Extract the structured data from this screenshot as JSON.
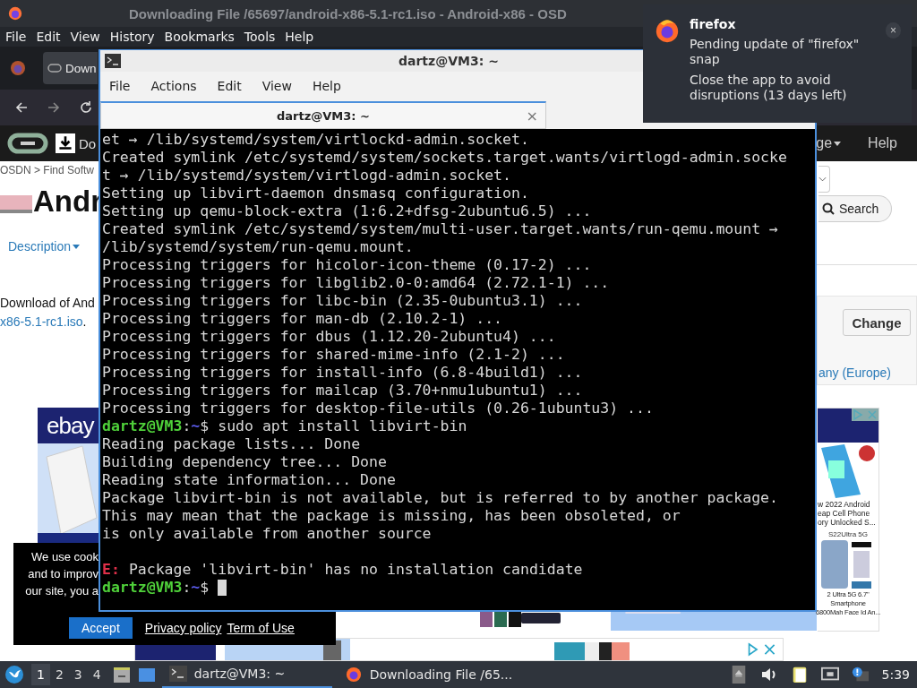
{
  "browser": {
    "title": "Downloading File /65697/android-x86-5.1-rc1.iso - Android-x86 - OSD",
    "menu": [
      "File",
      "Edit",
      "View",
      "History",
      "Bookmarks",
      "Tools",
      "Help"
    ],
    "tab": {
      "label": "Down"
    },
    "site": {
      "download_label": "Do",
      "nav": [
        {
          "label": "ge",
          "dropdown": true
        },
        {
          "label": "Help"
        }
      ],
      "breadcrumb": "OSDN > Find Softw",
      "heading": "Andr",
      "subnav": {
        "label": "Description",
        "dropdown": true
      },
      "search_button": "Search",
      "download_text": "Download of And",
      "file_link": "x86-5.1-rc1.iso",
      "file_link_end": ".",
      "change_button": "Change",
      "mirror": "any (Europe)",
      "ads": {
        "left_brand": "ebay",
        "right_lines": [
          "w 2022 Android",
          "eap Cell Phone",
          "ory Unlocked S..."
        ],
        "right_tag": "S22Ultra 5G",
        "right_lines_2": [
          "2 Ultra 5G 6.7\"",
          "Smartphone",
          "6800Mah Face Id An..."
        ]
      },
      "cookie": {
        "lines": [
          "We use cook",
          "and to improv",
          "our site, you a"
        ],
        "accept": "Accept",
        "links": [
          "Privacy policy",
          "Term of Use"
        ]
      }
    }
  },
  "terminal": {
    "title": "dartz@VM3: ~",
    "menu": [
      "File",
      "Actions",
      "Edit",
      "View",
      "Help"
    ],
    "tab": {
      "label": "dartz@VM3: ~",
      "close": "×"
    },
    "lines": [
      {
        "kind": "output",
        "text": "et → /lib/systemd/system/virtlockd-admin.socket."
      },
      {
        "kind": "output",
        "text": "Created symlink /etc/systemd/system/sockets.target.wants/virtlogd-admin.socke"
      },
      {
        "kind": "output",
        "text": "t → /lib/systemd/system/virtlogd-admin.socket."
      },
      {
        "kind": "output",
        "text": "Setting up libvirt-daemon dnsmasq configuration."
      },
      {
        "kind": "output",
        "text": "Setting up qemu-block-extra (1:6.2+dfsg-2ubuntu6.5) ..."
      },
      {
        "kind": "output",
        "text": "Created symlink /etc/systemd/system/multi-user.target.wants/run-qemu.mount →"
      },
      {
        "kind": "output",
        "text": "/lib/systemd/system/run-qemu.mount."
      },
      {
        "kind": "output",
        "text": "Processing triggers for hicolor-icon-theme (0.17-2) ..."
      },
      {
        "kind": "output",
        "text": "Processing triggers for libglib2.0-0:amd64 (2.72.1-1) ..."
      },
      {
        "kind": "output",
        "text": "Processing triggers for libc-bin (2.35-0ubuntu3.1) ..."
      },
      {
        "kind": "output",
        "text": "Processing triggers for man-db (2.10.2-1) ..."
      },
      {
        "kind": "output",
        "text": "Processing triggers for dbus (1.12.20-2ubuntu4) ..."
      },
      {
        "kind": "output",
        "text": "Processing triggers for shared-mime-info (2.1-2) ..."
      },
      {
        "kind": "output",
        "text": "Processing triggers for install-info (6.8-4build1) ..."
      },
      {
        "kind": "output",
        "text": "Processing triggers for mailcap (3.70+nmu1ubuntu1) ..."
      },
      {
        "kind": "output",
        "text": "Processing triggers for desktop-file-utils (0.26-1ubuntu3) ..."
      },
      {
        "kind": "prompt",
        "user": "dartz@VM3",
        "separator": ":",
        "path": "~",
        "symbol": "$",
        "command": "sudo apt install libvirt-bin"
      },
      {
        "kind": "output",
        "text": "Reading package lists... Done"
      },
      {
        "kind": "output",
        "text": "Building dependency tree... Done"
      },
      {
        "kind": "output",
        "text": "Reading state information... Done"
      },
      {
        "kind": "output",
        "text": "Package libvirt-bin is not available, but is referred to by another package."
      },
      {
        "kind": "output",
        "text": "This may mean that the package is missing, has been obsoleted, or"
      },
      {
        "kind": "output",
        "text": "is only available from another source"
      },
      {
        "kind": "blank"
      },
      {
        "kind": "error",
        "tag": "E:",
        "text": "Package 'libvirt-bin' has no installation candidate"
      },
      {
        "kind": "prompt",
        "user": "dartz@VM3",
        "separator": ":",
        "path": "~",
        "symbol": "$",
        "cursor": true
      }
    ]
  },
  "notification": {
    "app": "firefox",
    "lines": [
      "Pending update of \"firefox\" snap",
      "Close the app to avoid disruptions (13 days left)"
    ],
    "close": "×"
  },
  "taskbar": {
    "workspaces": [
      {
        "label": "1",
        "selected": true
      },
      {
        "label": "2",
        "selected": false
      },
      {
        "label": "3",
        "selected": false
      },
      {
        "label": "4",
        "selected": false
      }
    ],
    "tasks": [
      {
        "label": "dartz@VM3: ~",
        "kind": "terminal",
        "selected": true
      },
      {
        "label": "Downloading File /65...",
        "kind": "firefox",
        "selected": false
      }
    ],
    "clock": "5:39"
  }
}
